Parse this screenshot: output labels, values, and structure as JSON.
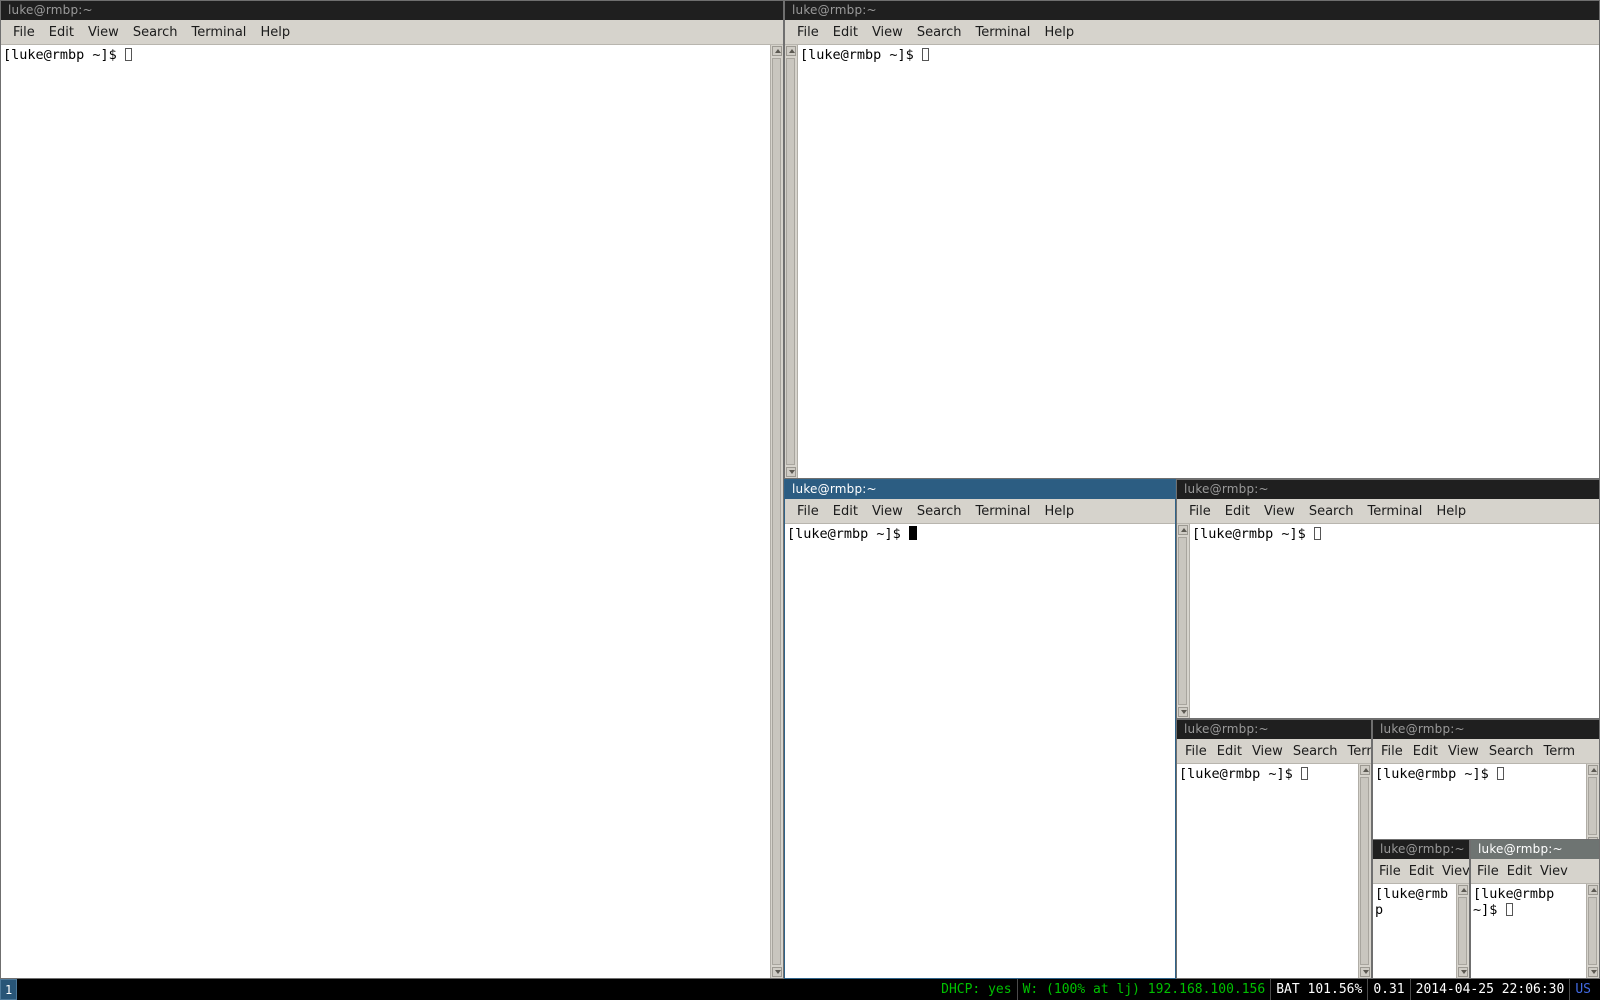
{
  "desktop": {
    "wm": "i3",
    "background_color": "#000000"
  },
  "menu_labels": {
    "file": "File",
    "edit": "Edit",
    "view": "View",
    "search": "Search",
    "terminal": "Terminal",
    "help": "Help",
    "terminal_short": "Term",
    "view_short": "Viev"
  },
  "colors": {
    "titlebar_inactive": "#1f1f1f",
    "titlebar_active": "#2c5d82",
    "titlebar_semi": "#6e7472",
    "chrome": "#d6d3cc",
    "terminal_bg": "#ffffff",
    "terminal_fg": "#000000",
    "status_bg": "#000000",
    "status_green": "#00c000",
    "status_white": "#ffffff",
    "status_blue": "#4169e1",
    "workspace_bg": "#285577",
    "workspace_border": "#4c7899"
  },
  "windows": [
    {
      "id": "win-1",
      "title": "luke@rmbp:~",
      "focused": false,
      "titlebar_style": "inactive",
      "prompt": "[luke@rmbp ~]$ ",
      "cursor": "hollow",
      "menu": [
        "File",
        "Edit",
        "View",
        "Search",
        "Terminal",
        "Help"
      ]
    },
    {
      "id": "win-2",
      "title": "luke@rmbp:~",
      "focused": false,
      "titlebar_style": "inactive",
      "prompt": "[luke@rmbp ~]$ ",
      "cursor": "hollow",
      "menu": [
        "File",
        "Edit",
        "View",
        "Search",
        "Terminal",
        "Help"
      ]
    },
    {
      "id": "win-3",
      "title": "luke@rmbp:~",
      "focused": true,
      "titlebar_style": "active",
      "prompt": "[luke@rmbp ~]$ ",
      "cursor": "block",
      "menu": [
        "File",
        "Edit",
        "View",
        "Search",
        "Terminal",
        "Help"
      ]
    },
    {
      "id": "win-4",
      "title": "luke@rmbp:~",
      "focused": false,
      "titlebar_style": "inactive",
      "prompt": "[luke@rmbp ~]$ ",
      "cursor": "hollow",
      "menu": [
        "File",
        "Edit",
        "View",
        "Search",
        "Terminal",
        "Help"
      ]
    },
    {
      "id": "win-5",
      "title": "luke@rmbp:~",
      "focused": false,
      "titlebar_style": "inactive",
      "prompt": "[luke@rmbp ~]$ ",
      "cursor": "hollow",
      "menu": [
        "File",
        "Edit",
        "View",
        "Search",
        "Term"
      ]
    },
    {
      "id": "win-6",
      "title": "luke@rmbp:~",
      "focused": false,
      "titlebar_style": "inactive",
      "prompt": "[luke@rmbp ~]$ ",
      "cursor": "hollow",
      "menu": [
        "File",
        "Edit",
        "View",
        "Search",
        "Term"
      ]
    },
    {
      "id": "win-7",
      "title": "luke@rmbp:~",
      "focused": false,
      "titlebar_style": "inactive",
      "prompt": "[luke@rmbp",
      "cursor": "none",
      "menu": [
        "File",
        "Edit",
        "Viev"
      ]
    },
    {
      "id": "win-8",
      "title": "luke@rmbp:~",
      "focused": false,
      "titlebar_style": "semi",
      "prompt": "[luke@rmbp\n~]$ ",
      "cursor": "hollow",
      "menu": [
        "File",
        "Edit",
        "Viev"
      ]
    }
  ],
  "statusbar": {
    "workspaces": [
      {
        "name": "1",
        "focused": true
      }
    ],
    "blocks": [
      {
        "name": "dhcp",
        "text": "DHCP: yes",
        "color": "#00c000"
      },
      {
        "name": "wifi",
        "text": "W: (100% at lj) 192.168.100.156",
        "color": "#00c000"
      },
      {
        "name": "battery",
        "text": "BAT 101.56%",
        "color": "#ffffff"
      },
      {
        "name": "load",
        "text": "0.31",
        "color": "#ffffff"
      },
      {
        "name": "datetime",
        "text": "2014-04-25 22:06:30",
        "color": "#ffffff"
      },
      {
        "name": "keyboard-layout",
        "text": "US",
        "color": "#4169e1"
      }
    ]
  }
}
